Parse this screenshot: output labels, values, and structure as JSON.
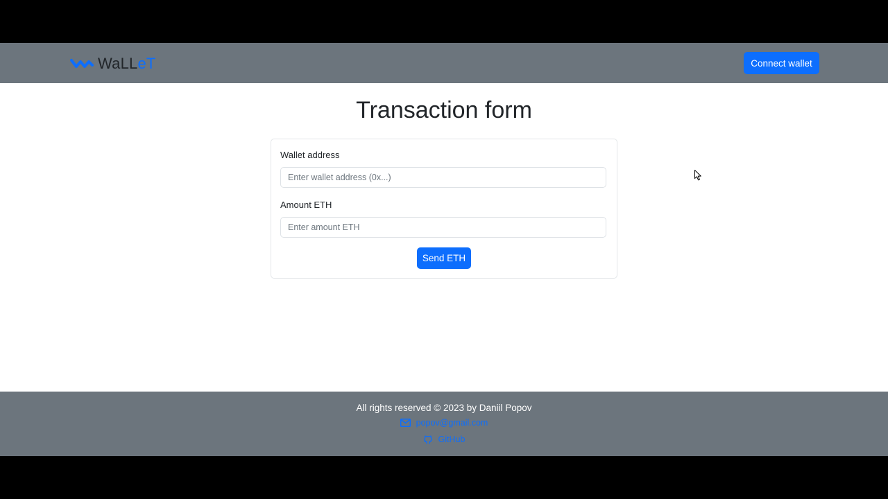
{
  "navbar": {
    "brand_part1": "WaLL",
    "brand_part2": "eT",
    "brand_icon": "wave-logo-icon",
    "connect_label": "Connect wallet"
  },
  "main": {
    "title": "Transaction form",
    "form": {
      "address_label": "Wallet address",
      "address_placeholder": "Enter wallet address (0x...)",
      "amount_label": "Amount ETH",
      "amount_placeholder": "Enter amount ETH",
      "send_label": "Send ETH"
    }
  },
  "footer": {
    "copyright": "All rights reserved © 2023 by Daniil Popov",
    "email_icon": "envelope-icon",
    "email": "popov@gmail.com",
    "github_icon": "github-icon",
    "github_label": "GitHub"
  },
  "colors": {
    "primary": "#0d6efd",
    "bar": "#6c757d",
    "text": "#212529",
    "letterbox": "#000000"
  }
}
